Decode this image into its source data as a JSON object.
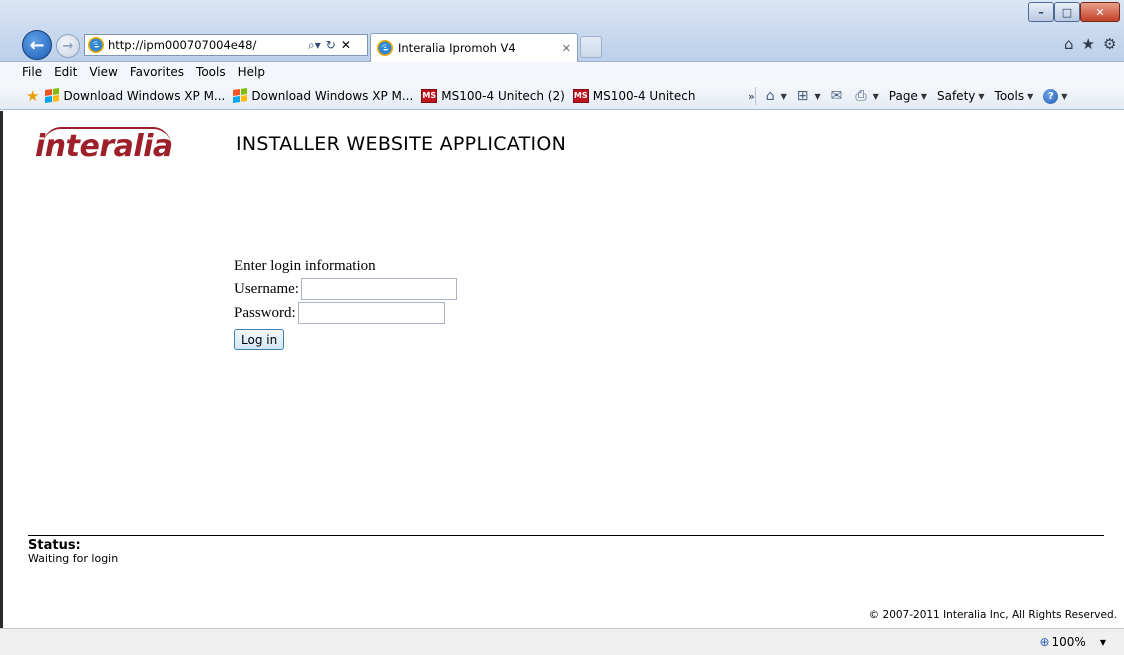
{
  "browser": {
    "address_url": "http://ipm000707004e48/",
    "search_icon": "search-icon",
    "tab_title": "Interalia Ipromoh V4"
  },
  "menu": {
    "file": "File",
    "edit": "Edit",
    "view": "View",
    "favorites": "Favorites",
    "tools": "Tools",
    "help": "Help"
  },
  "favorites": {
    "items": [
      "Download Windows XP M...",
      "Download Windows XP M...",
      "MS100-4 Unitech (2)",
      "MS100-4 Unitech"
    ]
  },
  "commands": {
    "page": "Page",
    "safety": "Safety",
    "tools": "Tools"
  },
  "page": {
    "logo_text": "interalia",
    "title": "INSTALLER WEBSITE APPLICATION",
    "login_heading": "Enter login information",
    "username_label": "Username:",
    "password_label": "Password:",
    "username_value": "",
    "password_value": "",
    "login_button": "Log in",
    "status_label": "Status:",
    "status_text": "Waiting for login",
    "copyright": "© 2007-2011 Interalia Inc, All Rights Reserved."
  },
  "statusbar": {
    "zoom": "100%"
  },
  "colors": {
    "brand": "#9c1f2a",
    "close_button": "#c2412a",
    "back_button": "#1d5fb6"
  }
}
